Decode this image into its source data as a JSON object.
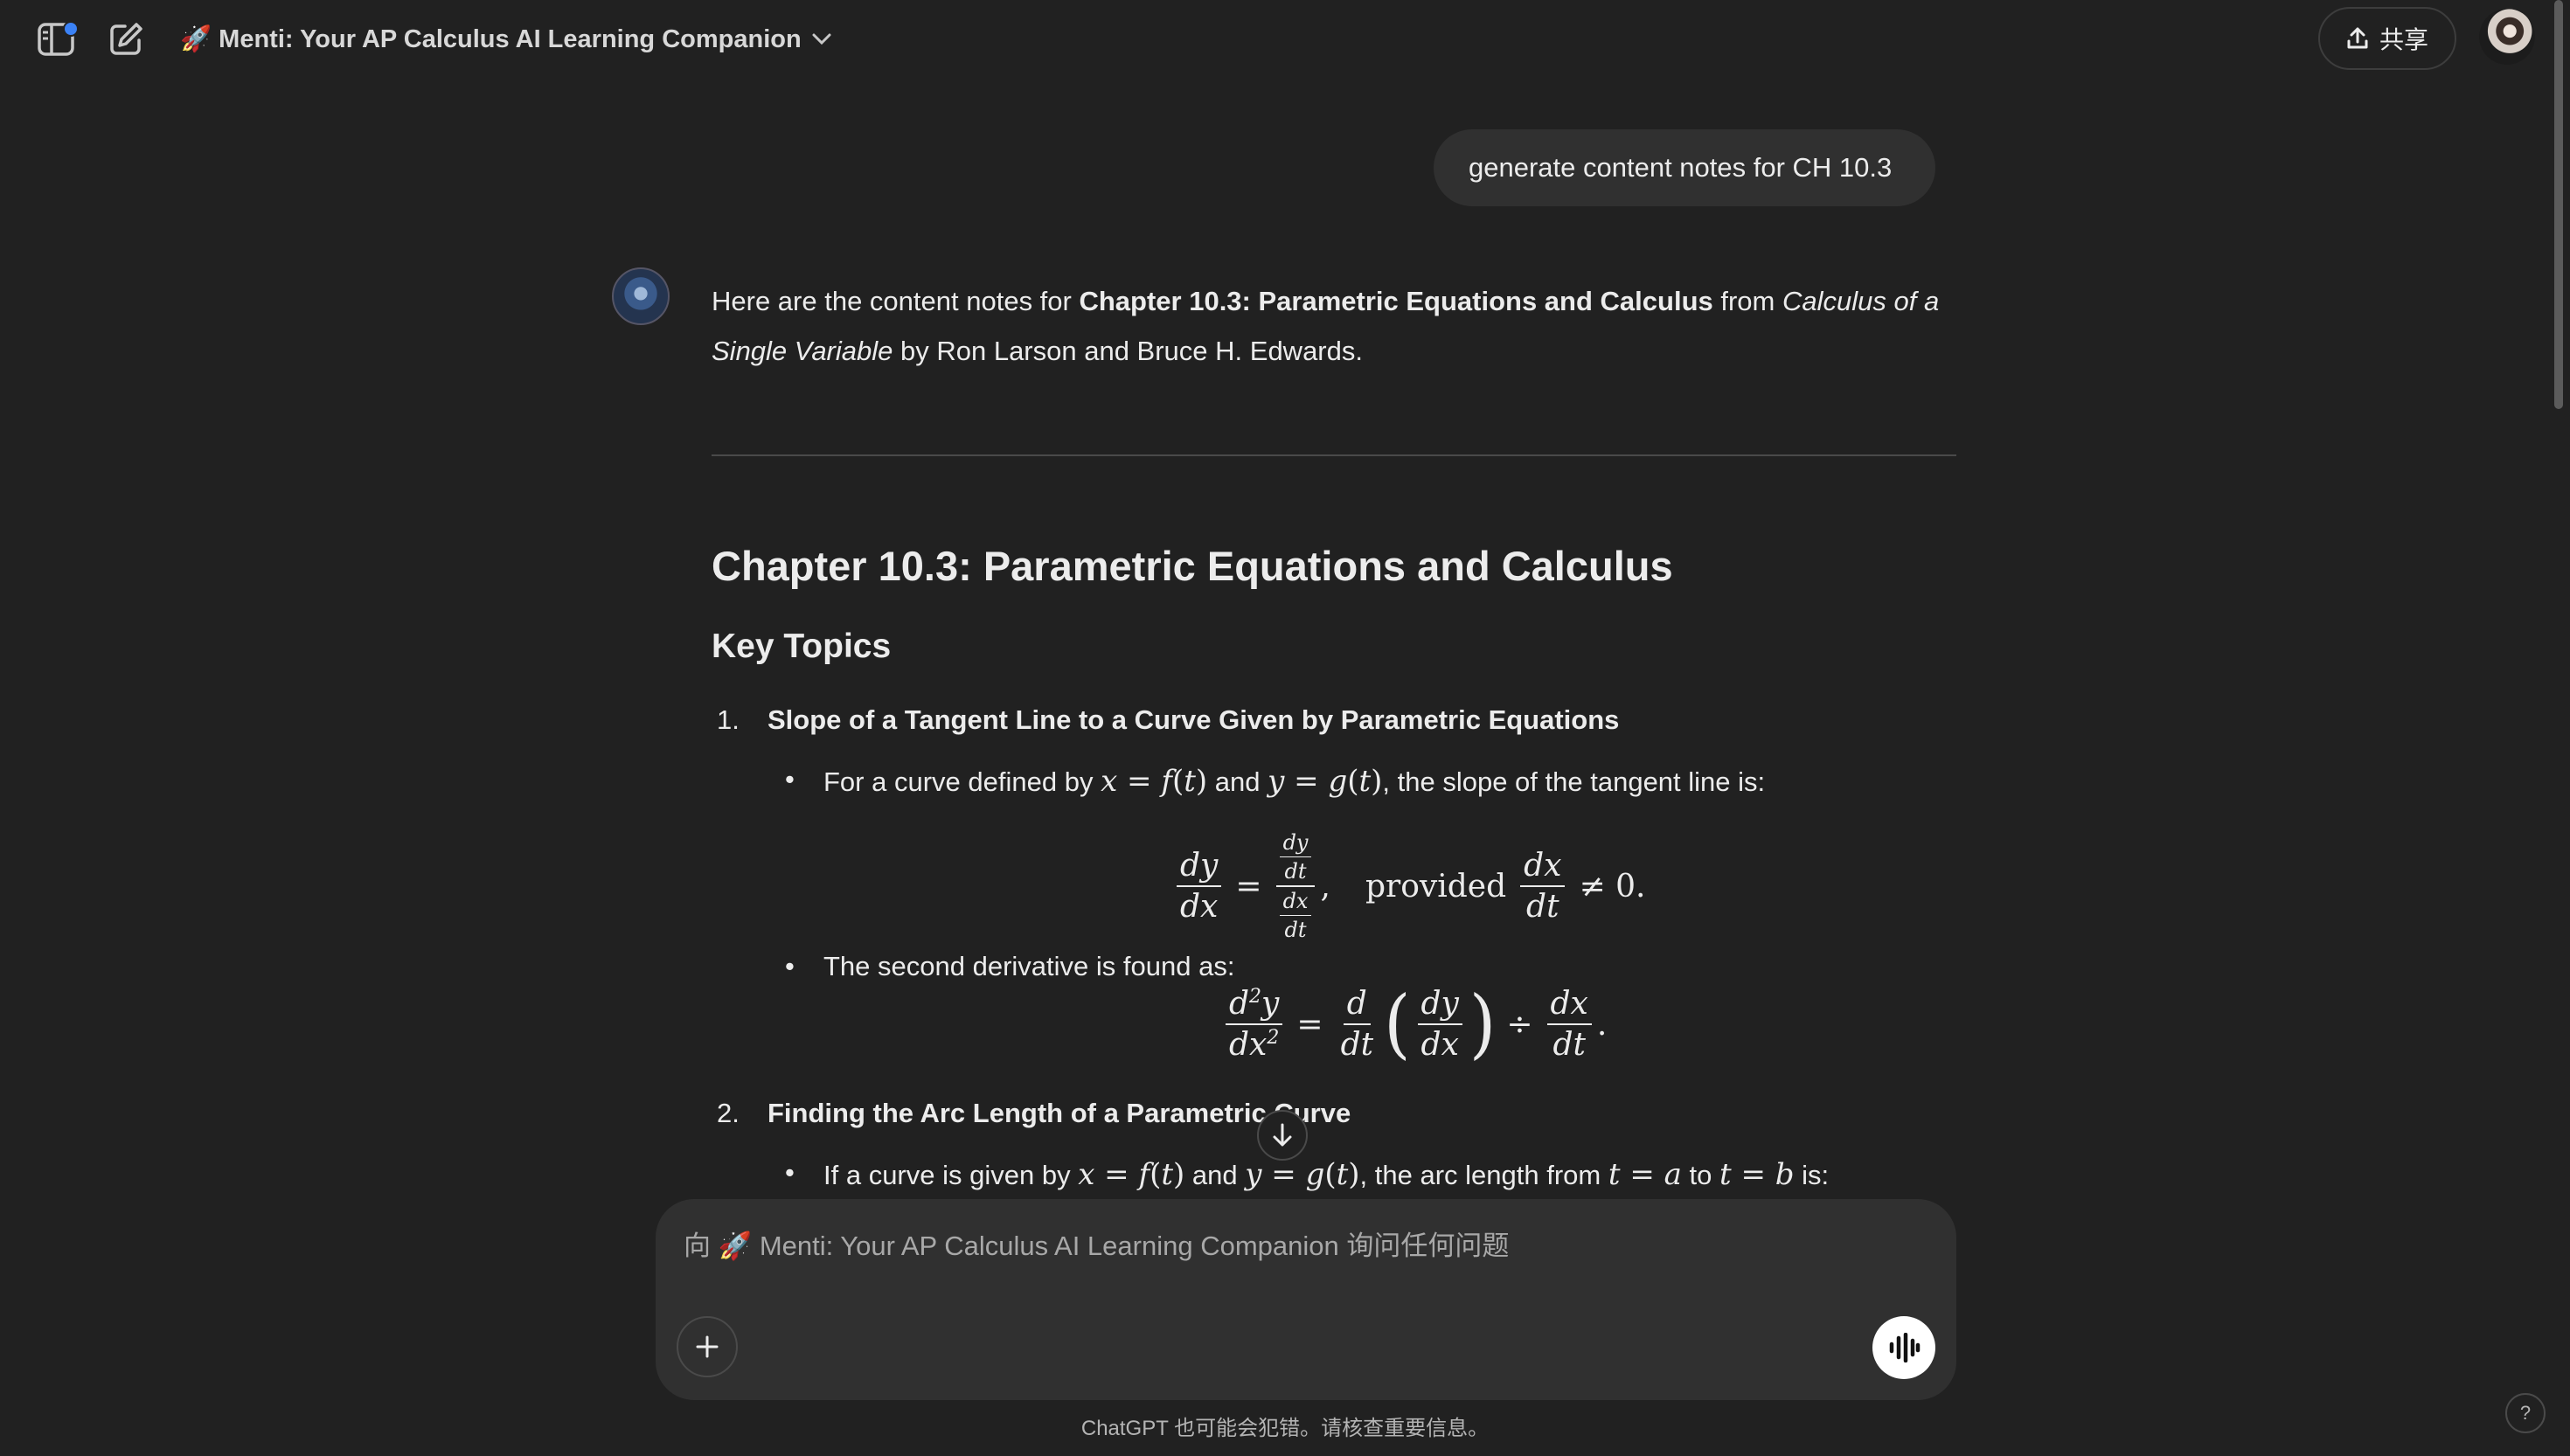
{
  "header": {
    "gpt_title": "🚀 Menti: Your AP Calculus AI Learning Companion",
    "share_label": "共享"
  },
  "user_message": "generate content notes for CH 10.3",
  "assistant": {
    "intro_pre": "Here are the content notes for ",
    "intro_bold": "Chapter 10.3: Parametric Equations and Calculus",
    "intro_mid": " from ",
    "intro_italic": "Calculus of a Single Variable",
    "intro_post": " by Ron Larson and Bruce H. Edwards.",
    "heading": "Chapter 10.3: Parametric Equations and Calculus",
    "subheading": "Key Topics",
    "topics": [
      {
        "number": "1.",
        "title": "Slope of a Tangent Line to a Curve Given by Parametric Equations",
        "bullet1_pre": "For a curve defined by ",
        "bullet1_and": " and ",
        "bullet1_post": ", the slope of the tangent line is:",
        "eq1_provided": "provided",
        "bullet2": "The second derivative is found as:"
      },
      {
        "number": "2.",
        "title": "Finding the Arc Length of a Parametric Curve",
        "bullet1_pre": "If a curve is given by ",
        "bullet1_and": " and ",
        "bullet1_mid": ", the arc length from ",
        "bullet1_to": " to ",
        "bullet1_post": " is:"
      }
    ]
  },
  "composer": {
    "placeholder": "向 🚀 Menti: Your AP Calculus AI Learning Companion 询问任何问题"
  },
  "footer": {
    "disclaimer": "ChatGPT 也可能会犯错。请核查重要信息。",
    "help": "?"
  }
}
